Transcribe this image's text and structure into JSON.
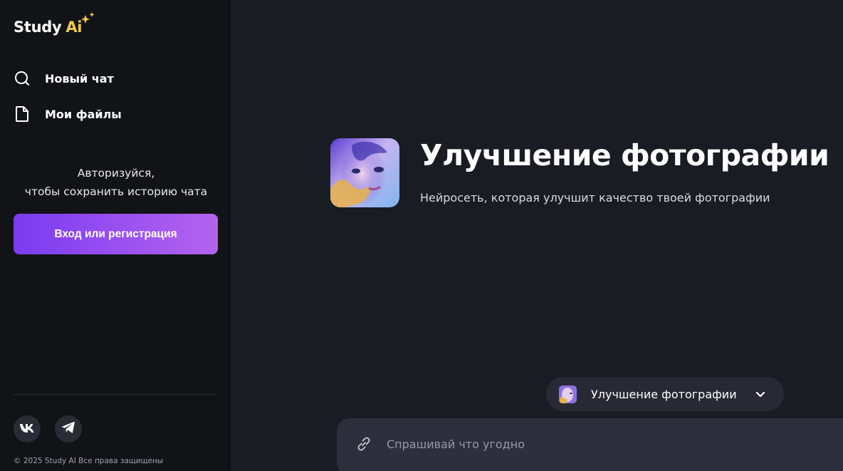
{
  "brand": {
    "name_part1": "Study",
    "name_part2": "Ai",
    "accent": "#f6c94a"
  },
  "sidebar": {
    "items": [
      {
        "label": "Новый чат",
        "icon": "search-icon"
      },
      {
        "label": "Мои файлы",
        "icon": "file-icon"
      }
    ],
    "auth_prompt_line1": "Авторизуйся,",
    "auth_prompt_line2": "чтобы сохранить историю чата",
    "login_button": "Вход или регистрация",
    "login_gradient": [
      "#7a3cf0",
      "#b563ee"
    ],
    "socials": [
      {
        "icon": "vk-icon"
      },
      {
        "icon": "telegram-icon"
      }
    ],
    "copyright": "© 2025 Study AI Все права защищены"
  },
  "main": {
    "title": "Улучшение фотографии",
    "subtitle": "Нейросеть, которая улучшит качество твоей фотографии",
    "model_selector": {
      "selected": "Улучшение фотографии"
    },
    "chat_input": {
      "placeholder": "Спрашивай что угодно",
      "value": ""
    }
  }
}
